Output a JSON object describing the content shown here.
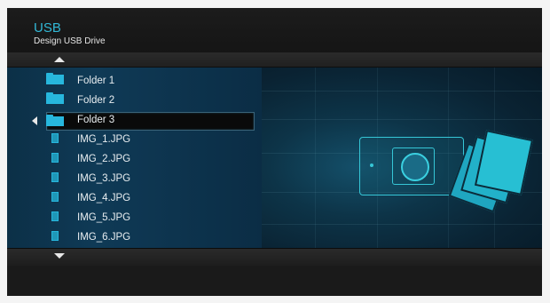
{
  "header": {
    "title": "USB",
    "subtitle": "Design USB Drive"
  },
  "list": {
    "items": [
      {
        "type": "folder",
        "label": "Folder 1",
        "icon": "folder-icon"
      },
      {
        "type": "folder",
        "label": "Folder 2",
        "icon": "folder-icon"
      },
      {
        "type": "folder",
        "label": "Folder 3",
        "icon": "folder-icon",
        "selected": true
      },
      {
        "type": "image",
        "label": "IMG_1.JPG",
        "icon": "image-file-icon"
      },
      {
        "type": "image",
        "label": "IMG_2.JPG",
        "icon": "image-file-icon"
      },
      {
        "type": "image",
        "label": "IMG_3.JPG",
        "icon": "image-file-icon"
      },
      {
        "type": "image",
        "label": "IMG_4.JPG",
        "icon": "image-file-icon"
      },
      {
        "type": "image",
        "label": "IMG_5.JPG",
        "icon": "image-file-icon"
      },
      {
        "type": "image",
        "label": "IMG_6.JPG",
        "icon": "image-file-icon"
      }
    ]
  },
  "colors": {
    "accent": "#27b7dd",
    "title": "#32b8d6",
    "panel": "#0f3a56"
  },
  "preview": {
    "icon": "photo-camera-icon"
  }
}
